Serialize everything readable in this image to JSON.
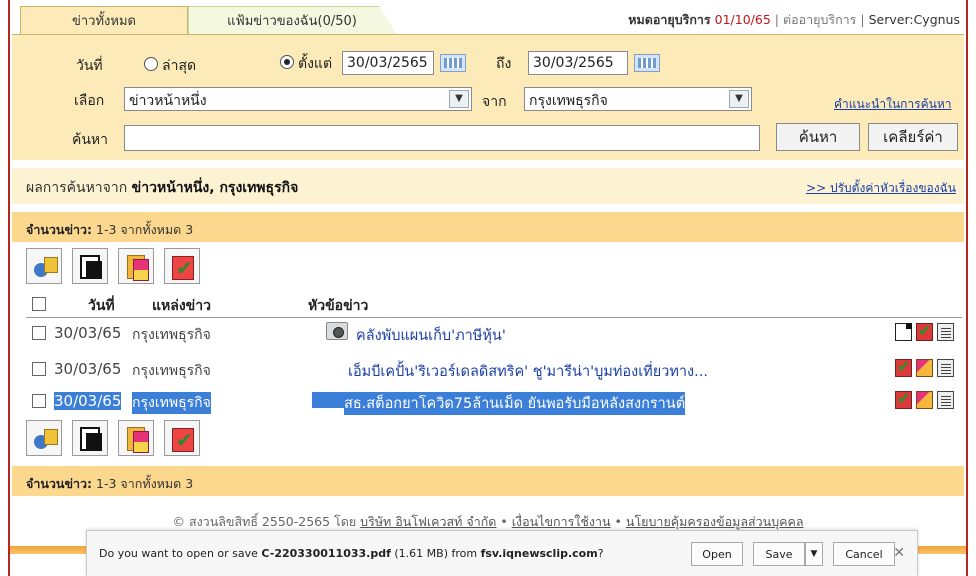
{
  "tabs": [
    {
      "label": "ข่าวทั้งหมด"
    },
    {
      "label": "แฟ้มข่าวของฉัน(0/50)"
    }
  ],
  "top": {
    "expiry_label": "หมดอายุบริการ",
    "expiry_date": "01/10/65",
    "renew": "ต่ออายุบริการ",
    "server": "Server:Cygnus"
  },
  "search": {
    "date_label": "วันที่",
    "latest": "ล่าสุด",
    "since": "ตั้งแต่",
    "from_date": "30/03/2565",
    "to_label": "ถึง",
    "to_date": "30/03/2565",
    "select_label": "เลือก",
    "category": "ข่าวหน้าหนึ่ง",
    "from_label": "จาก",
    "source": "กรุงเทพธุรกิจ",
    "tips": "คำแนะนำในการค้นหา",
    "query_label": "ค้นหา",
    "query": "",
    "search_btn": "ค้นหา",
    "clear_btn": "เคลียร์ค่า"
  },
  "results": {
    "prefix": "ผลการค้นหาจาก",
    "criteria": "ข่าวหน้าหนึ่ง, กรุงเทพธุรกิจ",
    "customize": ">> ปรับตั้งค่าหัวเรื่องของฉัน",
    "count_label": "จำนวนข่าว:",
    "count_value": "1-3 จากทั้งหมด 3"
  },
  "table": {
    "headers": {
      "date": "วันที่",
      "source": "แหล่งข่าว",
      "title": "หัวข้อข่าว"
    },
    "rows": [
      {
        "date": "30/03/65",
        "source": "กรุงเทพธุรกิจ",
        "title": "คลังพับแผนเก็บ'ภาษีหุ้น'"
      },
      {
        "date": "30/03/65",
        "source": "กรุงเทพธุรกิจ",
        "title": "เอ็มบีเคปั้น'ริเวอร์เดลดิสทริค' ชู'มารีน่า'บูมท่องเที่ยวทาง..."
      },
      {
        "date": "30/03/65",
        "source": "กรุงเทพธุรกิจ",
        "title": "สธ.สต็อกยาโควิด75ล้านเม็ด ยันพอรับมือหลังสงกรานต์"
      }
    ]
  },
  "footer": {
    "copyright": "© สงวนลิขสิทธิ์ 2550-2565 โดย",
    "company": "บริษัท อินโฟเควสท์ จำกัด",
    "terms": "เงื่อนไขการใช้งาน",
    "privacy": "นโยบายคุ้มครองข้อมูลส่วนบุคคล"
  },
  "download": {
    "q_prefix": "Do you want to open or save",
    "filename": "C-220330011033.pdf",
    "size": "(1.61 MB) from",
    "host": "fsv.iqnewsclip.com",
    "q_suffix": "?",
    "open": "Open",
    "save": "Save",
    "cancel": "Cancel"
  }
}
